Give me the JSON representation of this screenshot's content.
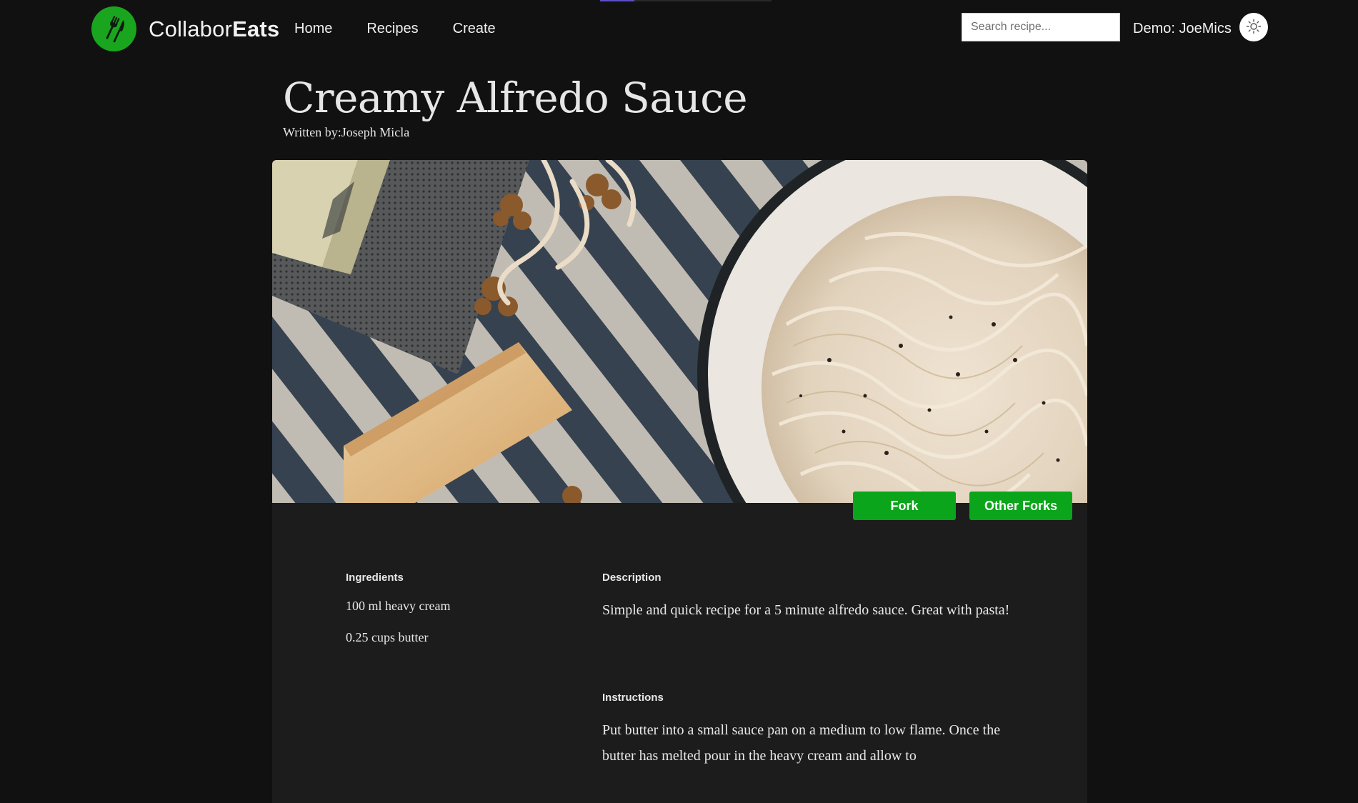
{
  "app": {
    "brand_light": "Collabor",
    "brand_bold": "Eats",
    "accent_color": "#1aa51f",
    "button_color": "#0aa51a"
  },
  "nav": {
    "links": [
      {
        "label": "Home"
      },
      {
        "label": "Recipes"
      },
      {
        "label": "Create"
      }
    ]
  },
  "search": {
    "placeholder": "Search recipe..."
  },
  "user": {
    "label": "Demo: JoeMics"
  },
  "recipe": {
    "title": "Creamy Alfredo Sauce",
    "author_line": "Written by:Joseph Micla",
    "image_alt": "Creamy Alfredo Sauce",
    "actions": {
      "fork_label": "Fork",
      "other_forks_label": "Other Forks"
    },
    "ingredients_label": "Ingredients",
    "ingredients": [
      "100 ml heavy cream",
      "0.25 cups butter"
    ],
    "description_label": "Description",
    "description": "Simple and quick recipe for a 5 minute alfredo sauce. Great with pasta!",
    "instructions_label": "Instructions",
    "instructions": "Put butter into a small sauce pan on a medium to low flame. Once the butter has melted pour in the heavy cream and allow to"
  },
  "icons": {
    "logo": "fork-knife-icon",
    "theme": "sun-icon"
  }
}
